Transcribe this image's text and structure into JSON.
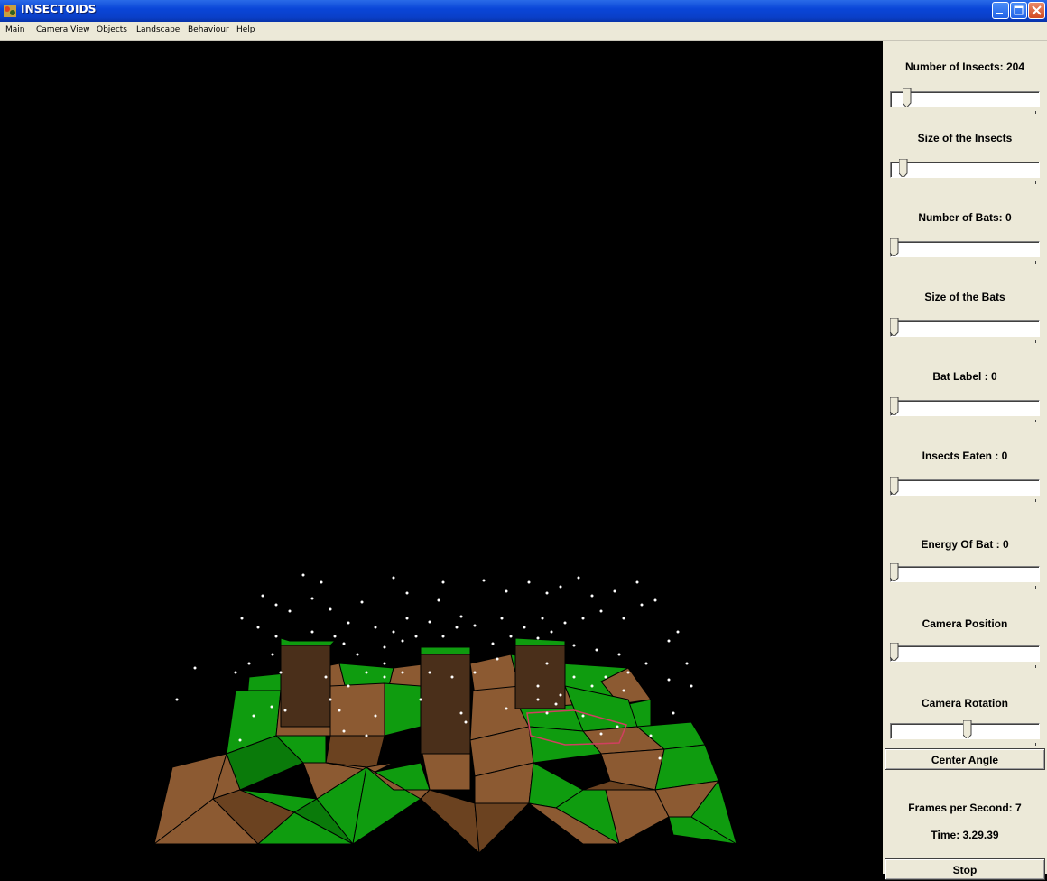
{
  "window": {
    "title": "INSECTOIDS"
  },
  "menu": [
    "Main",
    "Camera View",
    "Objects",
    "Landscape",
    "Behaviour",
    "Help"
  ],
  "panel": {
    "controls": [
      {
        "label": "Number of Insects: 204",
        "value": 0.12
      },
      {
        "label": "Size of the Insects",
        "value": 0.06
      },
      {
        "label": "Number of Bats: 0",
        "value": 0.0
      },
      {
        "label": "Size of the Bats",
        "value": 0.0
      },
      {
        "label": "Bat Label : 0",
        "value": 0.0
      },
      {
        "label": "Insects Eaten : 0",
        "value": 0.0
      },
      {
        "label": "Energy Of Bat : 0",
        "value": 0.0
      },
      {
        "label": "Camera Position",
        "value": 0.0
      },
      {
        "label": "Camera Rotation",
        "value": 0.5
      }
    ],
    "center_button": "Center Angle",
    "fps": "Frames per Second: 7",
    "time": "Time: 3.29.39",
    "stop_button": "Stop"
  },
  "colors": {
    "grass": "#0f9c0f",
    "grass_dark": "#0a7a0a",
    "dirt": "#8c5a32",
    "dirt_dark": "#6b4220",
    "pillar": "#4a2f1a",
    "titlebar": "#0a46d8",
    "panel": "#ece9d8"
  }
}
